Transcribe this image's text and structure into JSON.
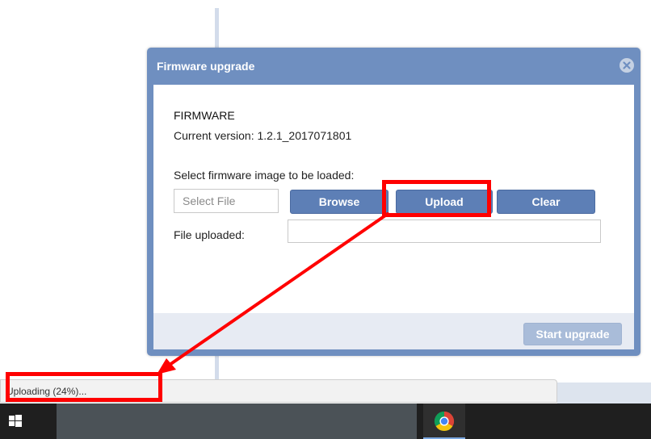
{
  "dialog": {
    "title": "Firmware upgrade",
    "section_title": "FIRMWARE",
    "version_label": "Current version: 1.2.1_2017071801",
    "select_label": "Select firmware image to be loaded:",
    "file_placeholder": "Select File",
    "browse_label": "Browse",
    "upload_label": "Upload",
    "clear_label": "Clear",
    "uploaded_label": "File uploaded:",
    "uploaded_value": "",
    "start_label": "Start upgrade"
  },
  "status_bar": {
    "text": "Uploading (24%)..."
  },
  "annotations": {
    "color": "#ff0000"
  },
  "taskbar": {
    "start_icon": "windows-logo-icon",
    "app_icon": "chrome-icon"
  }
}
